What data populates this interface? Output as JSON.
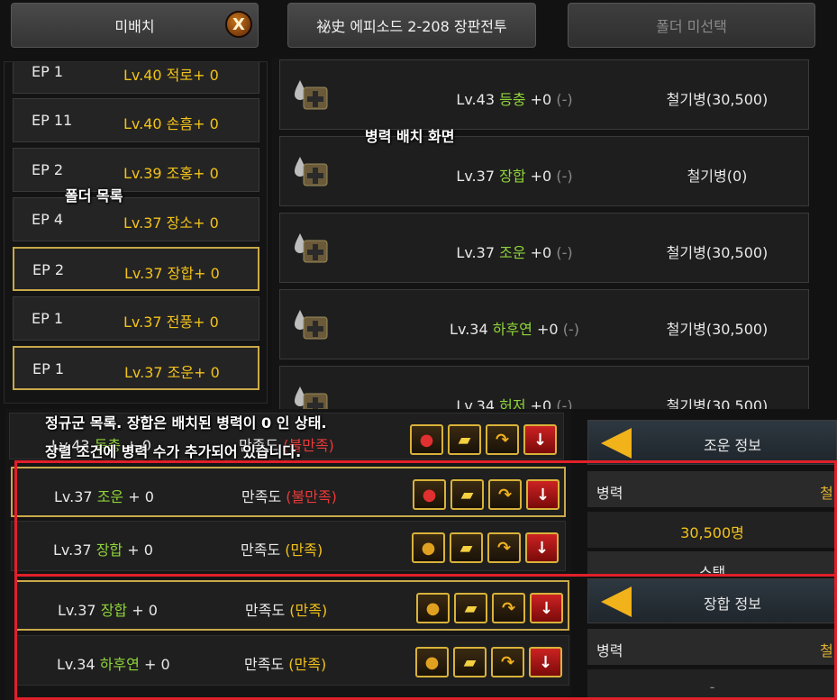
{
  "top": {
    "unassign_label": "미배치",
    "close_symbol": "X",
    "episode_label": "祕史 에피소드 2-208 장판전투",
    "folder_unselected_label": "폴더 미선택"
  },
  "folders": [
    {
      "ep": "EP 1",
      "lv": "Lv.40 적로+ 0",
      "selected": false
    },
    {
      "ep": "EP 11",
      "lv": "Lv.40 손흠+ 0",
      "selected": false
    },
    {
      "ep": "EP 2",
      "lv": "Lv.39 조홍+ 0",
      "selected": false
    },
    {
      "ep": "EP 4",
      "lv": "Lv.37 장소+ 0",
      "selected": false
    },
    {
      "ep": "EP 2",
      "lv": "Lv.37 장합+ 0",
      "selected": true
    },
    {
      "ep": "EP 1",
      "lv": "Lv.37 전풍+ 0",
      "selected": false
    },
    {
      "ep": "EP 1",
      "lv": "Lv.37 조운+ 0",
      "selected": true
    }
  ],
  "troops": [
    {
      "lv": "Lv.43",
      "name": "등충",
      "plus": "+0",
      "minus": "(-)",
      "cavalry": "철기병(30,500)"
    },
    {
      "lv": "Lv.37",
      "name": "장합",
      "plus": "+0",
      "minus": "(-)",
      "cavalry": "철기병(0)"
    },
    {
      "lv": "Lv.37",
      "name": "조운",
      "plus": "+0",
      "minus": "(-)",
      "cavalry": "철기병(30,500)"
    },
    {
      "lv": "Lv.34",
      "name": "하후연",
      "plus": "+0",
      "minus": "(-)",
      "cavalry": "철기병(30,500)"
    },
    {
      "lv": "Lv.34",
      "name": "허저",
      "plus": "+0",
      "minus": "(-)",
      "cavalry": "철기병(30,500)"
    }
  ],
  "army": [
    {
      "lv": "Lv.43",
      "name": "등충",
      "plus": "+ 0",
      "sat_label": "만족도",
      "sat": "(불만족)",
      "sat_color": "#e83a3a"
    },
    {
      "lv": "Lv.37",
      "name": "조운",
      "plus": "+ 0",
      "sat_label": "만족도",
      "sat": "(불만족)",
      "sat_color": "#e83a3a"
    },
    {
      "lv": "Lv.37",
      "name": "장합",
      "plus": "+ 0",
      "sat_label": "만족도",
      "sat": "(만족)",
      "sat_color": "#f2c21a"
    },
    {
      "lv": "Lv.37",
      "name": "장합",
      "plus": "+ 0",
      "sat_label": "만족도",
      "sat": "(만족)",
      "sat_color": "#f2c21a"
    },
    {
      "lv": "Lv.34",
      "name": "하후연",
      "plus": "+ 0",
      "sat_label": "만족도",
      "sat": "(만족)",
      "sat_color": "#f2c21a"
    }
  ],
  "info1": {
    "title": "조운 정보",
    "troop_label": "병력",
    "troop_value_partial": "철",
    "count": "30,500명",
    "stat_label": "스탯"
  },
  "info2": {
    "title": "장합 정보",
    "troop_label": "병력",
    "troop_value_partial": "철",
    "count": "-"
  },
  "notes": {
    "troop_screen": "병력 배치 화면",
    "folder_list": "폴더 목록",
    "army_line1": "정규군 목록. 장합은 배치된 병력이 0 인 상태.",
    "army_line2": "장렬 조건에 병력 수가 추가되어 있습니다."
  },
  "colors": {
    "accent_gold": "#c9a94a",
    "annotation_red": "#e0202a",
    "name_green": "#8fd43a",
    "level_yellow": "#f2c21a"
  }
}
